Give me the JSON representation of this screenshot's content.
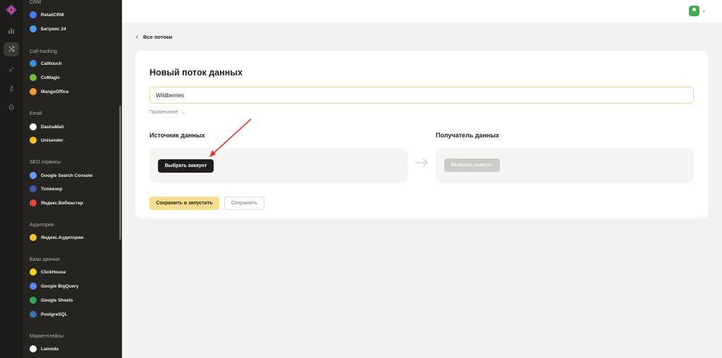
{
  "sidebar": {
    "sections": [
      {
        "title": "CRM",
        "items": [
          {
            "label": "RetailCRM",
            "icon": "retailcrm-icon",
            "color": "#4a7cf6"
          },
          {
            "label": "Битрикс 24",
            "icon": "bitrix24-icon",
            "color": "#4b9df0"
          }
        ]
      },
      {
        "title": "Call-tracking",
        "items": [
          {
            "label": "Calltouch",
            "icon": "calltouch-icon",
            "color": "#3a8fd9"
          },
          {
            "label": "CoMagic",
            "icon": "comagic-icon",
            "color": "#6bbf3d"
          },
          {
            "label": "MangoOffice",
            "icon": "mangooffice-icon",
            "color": "#f29a2e"
          }
        ]
      },
      {
        "title": "Email",
        "items": [
          {
            "label": "DashaMail",
            "icon": "dashamail-icon",
            "color": "#ffffff"
          },
          {
            "label": "Unisender",
            "icon": "unisender-icon",
            "color": "#f5c21a"
          }
        ]
      },
      {
        "title": "SEO сервисы",
        "items": [
          {
            "label": "Google Search Console",
            "icon": "google-search-console-icon",
            "color": "#6a9ff2"
          },
          {
            "label": "Топвизор",
            "icon": "topvisor-icon",
            "color": "#3b5aa8"
          },
          {
            "label": "Яндекс.Вебмастер",
            "icon": "yandex-webmaster-icon",
            "color": "#e0463a"
          }
        ]
      },
      {
        "title": "Аудитории",
        "items": [
          {
            "label": "Яндекс.Аудитории",
            "icon": "yandex-audience-icon",
            "color": "#f2c230"
          }
        ]
      },
      {
        "title": "Базы данных",
        "items": [
          {
            "label": "ClickHouse",
            "icon": "clickhouse-icon",
            "color": "#f5d21a"
          },
          {
            "label": "Google BigQuery",
            "icon": "google-bigquery-icon",
            "color": "#5a86e8"
          },
          {
            "label": "Google Sheets",
            "icon": "google-sheets-icon",
            "color": "#2fa85a"
          },
          {
            "label": "PostgreSQL",
            "icon": "postgresql-icon",
            "color": "#3c6fa8"
          }
        ]
      },
      {
        "title": "Маркетплейсы",
        "items": [
          {
            "label": "Lamoda",
            "icon": "lamoda-icon",
            "color": "#ffffff"
          }
        ]
      }
    ]
  },
  "header": {
    "avatar_color": "#3fae4f"
  },
  "back_link": {
    "label": "Все потоки"
  },
  "form": {
    "title": "Новый поток данных",
    "name_value": "Wildberries",
    "note_label": "Примечание",
    "source": {
      "heading": "Источник данных",
      "button_label": "Выбрать аккаунт"
    },
    "destination": {
      "heading": "Получатель данных",
      "button_label": "Выбрать аккаунт"
    },
    "save_and_run_label": "Сохранить и запустить",
    "save_label": "Сохранить"
  },
  "colors": {
    "accent_yellow": "#f5df8f",
    "annotation_arrow": "#e03a2f"
  }
}
